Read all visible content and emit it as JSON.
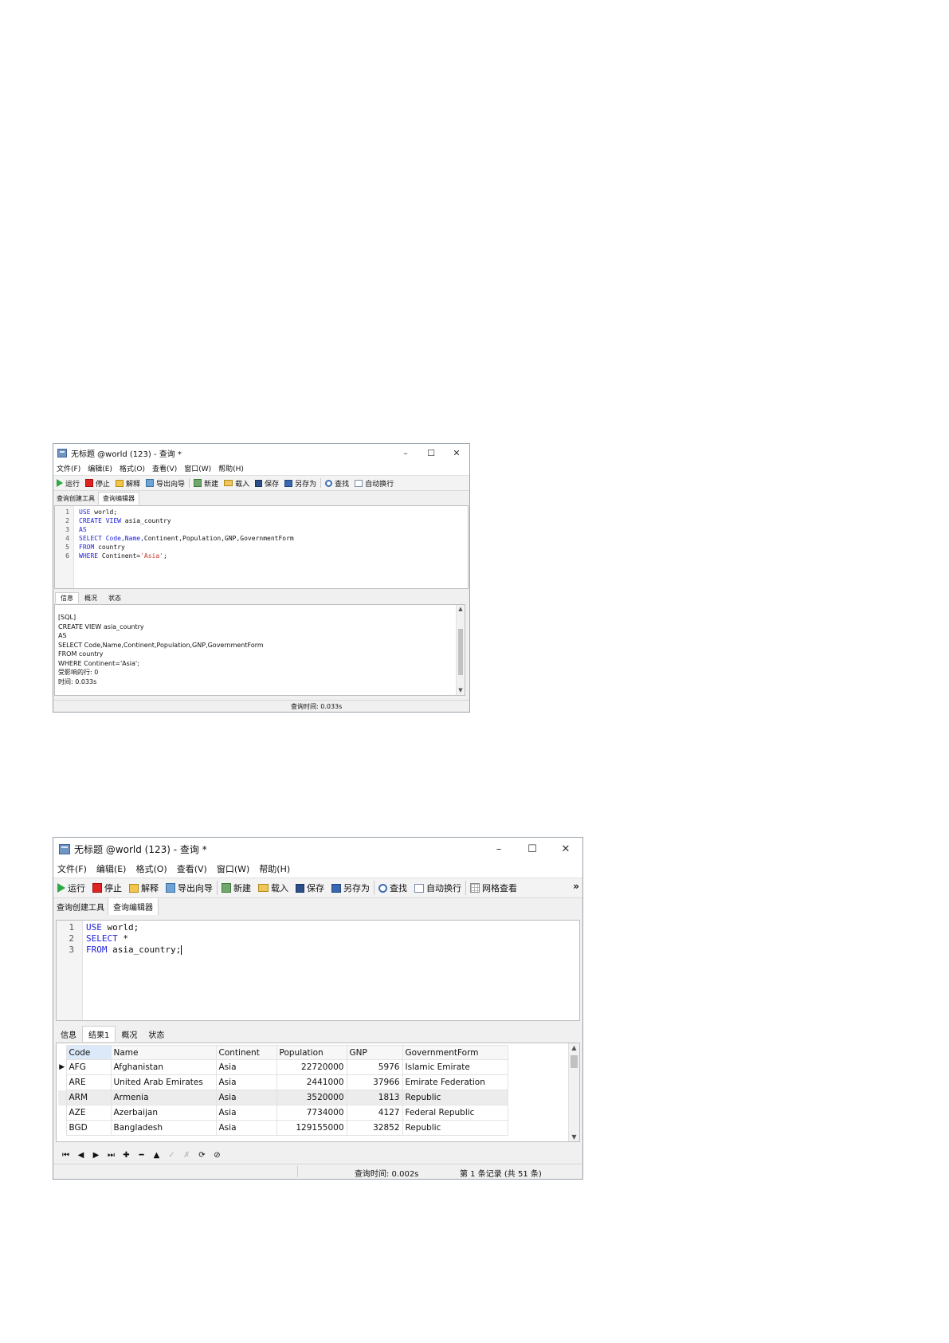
{
  "window1": {
    "title": "无标题 @world (123) - 查询 *",
    "controls": {
      "minimize": "–",
      "maximize": "☐",
      "close": "✕"
    },
    "menu": [
      "文件(F)",
      "编辑(E)",
      "格式(O)",
      "查看(V)",
      "窗口(W)",
      "帮助(H)"
    ],
    "toolbar": {
      "run": "运行",
      "stop": "停止",
      "explain": "解释",
      "export_wizard": "导出向导",
      "new": "新建",
      "load": "载入",
      "save": "保存",
      "save_as": "另存为",
      "find": "查找",
      "auto_wrap": "自动换行"
    },
    "subtabs": [
      "查询创建工具",
      "查询编辑器"
    ],
    "editor": {
      "line_numbers": [
        "1",
        "2",
        "3",
        "4",
        "5",
        "6"
      ],
      "lines": [
        {
          "kw": "USE",
          "rest": " world;"
        },
        {
          "kw": "CREATE VIEW",
          "rest": " asia_country"
        },
        {
          "kw": "AS",
          "rest": ""
        },
        {
          "kw": "SELECT",
          "rest_kw": " Code,Name,",
          "rest": "Continent,Population,GNP,GovernmentForm"
        },
        {
          "kw": "FROM",
          "rest": " country"
        },
        {
          "kw": "WHERE",
          "rest": " Continent=",
          "str": "'Asia'",
          "tail": ";"
        }
      ]
    },
    "result_tabs": [
      "信息",
      "概况",
      "状态"
    ],
    "info_lines": [
      "[SQL]",
      "CREATE VIEW asia_country",
      "AS",
      "SELECT Code,Name,Continent,Population,GNP,GovernmentForm",
      "FROM country",
      "WHERE Continent='Asia';",
      "受影响的行: 0",
      "时间: 0.033s"
    ],
    "status": "查询时间: 0.033s"
  },
  "window2": {
    "title": "无标题 @world (123) - 查询 *",
    "controls": {
      "minimize": "–",
      "maximize": "☐",
      "close": "✕"
    },
    "menu": [
      "文件(F)",
      "编辑(E)",
      "格式(O)",
      "查看(V)",
      "窗口(W)",
      "帮助(H)"
    ],
    "toolbar": {
      "run": "运行",
      "stop": "停止",
      "explain": "解释",
      "export_wizard": "导出向导",
      "new": "新建",
      "load": "载入",
      "save": "保存",
      "save_as": "另存为",
      "find": "查找",
      "auto_wrap": "自动换行",
      "grid_view": "网格查看",
      "overflow": "»"
    },
    "subtabs": [
      "查询创建工具",
      "查询编辑器"
    ],
    "editor": {
      "line_numbers": [
        "1",
        "2",
        "3"
      ],
      "lines": [
        {
          "kw": "USE",
          "rest": " world;"
        },
        {
          "kw": "SELECT",
          "rest": " *"
        },
        {
          "kw": "FROM",
          "rest": " asia_country;"
        }
      ]
    },
    "result_tabs": [
      "信息",
      "结果1",
      "概况",
      "状态"
    ],
    "table": {
      "columns": [
        "Code",
        "Name",
        "Continent",
        "Population",
        "GNP",
        "GovernmentForm"
      ],
      "rows": [
        [
          "AFG",
          "Afghanistan",
          "Asia",
          "22720000",
          "5976",
          "Islamic Emirate"
        ],
        [
          "ARE",
          "United Arab Emirates",
          "Asia",
          "2441000",
          "37966",
          "Emirate Federation"
        ],
        [
          "ARM",
          "Armenia",
          "Asia",
          "3520000",
          "1813",
          "Republic"
        ],
        [
          "AZE",
          "Azerbaijan",
          "Asia",
          "7734000",
          "4127",
          "Federal Republic"
        ],
        [
          "BGD",
          "Bangladesh",
          "Asia",
          "129155000",
          "32852",
          "Republic"
        ]
      ],
      "row_marker": "▶"
    },
    "nav_buttons": [
      {
        "name": "first-record-button",
        "glyph": "⏮"
      },
      {
        "name": "prev-record-button",
        "glyph": "◀"
      },
      {
        "name": "next-record-button",
        "glyph": "▶"
      },
      {
        "name": "last-record-button",
        "glyph": "⏭"
      },
      {
        "name": "add-record-button",
        "glyph": "✚"
      },
      {
        "name": "delete-record-button",
        "glyph": "━"
      },
      {
        "name": "move-up-button",
        "glyph": "▲"
      },
      {
        "name": "apply-button",
        "glyph": "✓"
      },
      {
        "name": "discard-button",
        "glyph": "✗"
      },
      {
        "name": "refresh-button",
        "glyph": "⟳"
      },
      {
        "name": "stop-query-button",
        "glyph": "⊘"
      }
    ],
    "status_time": "查询时间: 0.002s",
    "status_records": "第 1 条记录 (共 51 条)"
  },
  "colors": {
    "keyword": "#2222dd",
    "string": "#c0392b",
    "run_icon": "#2ea843",
    "stop_icon": "#e02424"
  }
}
